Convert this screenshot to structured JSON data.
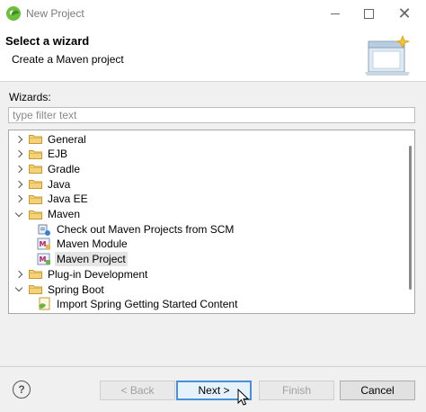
{
  "window": {
    "title": "New Project"
  },
  "header": {
    "title": "Select a wizard",
    "description": "Create a Maven project"
  },
  "wizards": {
    "label": "Wizards:",
    "filter_placeholder": "type filter text",
    "tree": [
      {
        "label": "General",
        "kind": "folder",
        "expanded": false,
        "level": 0
      },
      {
        "label": "EJB",
        "kind": "folder",
        "expanded": false,
        "level": 0
      },
      {
        "label": "Gradle",
        "kind": "folder",
        "expanded": false,
        "level": 0
      },
      {
        "label": "Java",
        "kind": "folder",
        "expanded": false,
        "level": 0
      },
      {
        "label": "Java EE",
        "kind": "folder",
        "expanded": false,
        "level": 0
      },
      {
        "label": "Maven",
        "kind": "folder",
        "expanded": true,
        "level": 0
      },
      {
        "label": "Check out Maven Projects from SCM",
        "kind": "wizard",
        "icon": "scm-checkout-icon",
        "level": 1
      },
      {
        "label": "Maven Module",
        "kind": "wizard",
        "icon": "maven-module-icon",
        "level": 1
      },
      {
        "label": "Maven Project",
        "kind": "wizard",
        "icon": "maven-project-icon",
        "level": 1,
        "selected": true
      },
      {
        "label": "Plug-in Development",
        "kind": "folder",
        "expanded": false,
        "level": 0
      },
      {
        "label": "Spring Boot",
        "kind": "folder",
        "expanded": true,
        "level": 0
      },
      {
        "label": "Import Spring Getting Started Content",
        "kind": "wizard",
        "icon": "spring-import-icon",
        "level": 1
      }
    ]
  },
  "buttons": {
    "back": "< Back",
    "next": "Next >",
    "finish": "Finish",
    "cancel": "Cancel"
  },
  "colors": {
    "accent": "#4a90d9",
    "folder": "#e8b84a",
    "selection": "#e5e5e5"
  }
}
